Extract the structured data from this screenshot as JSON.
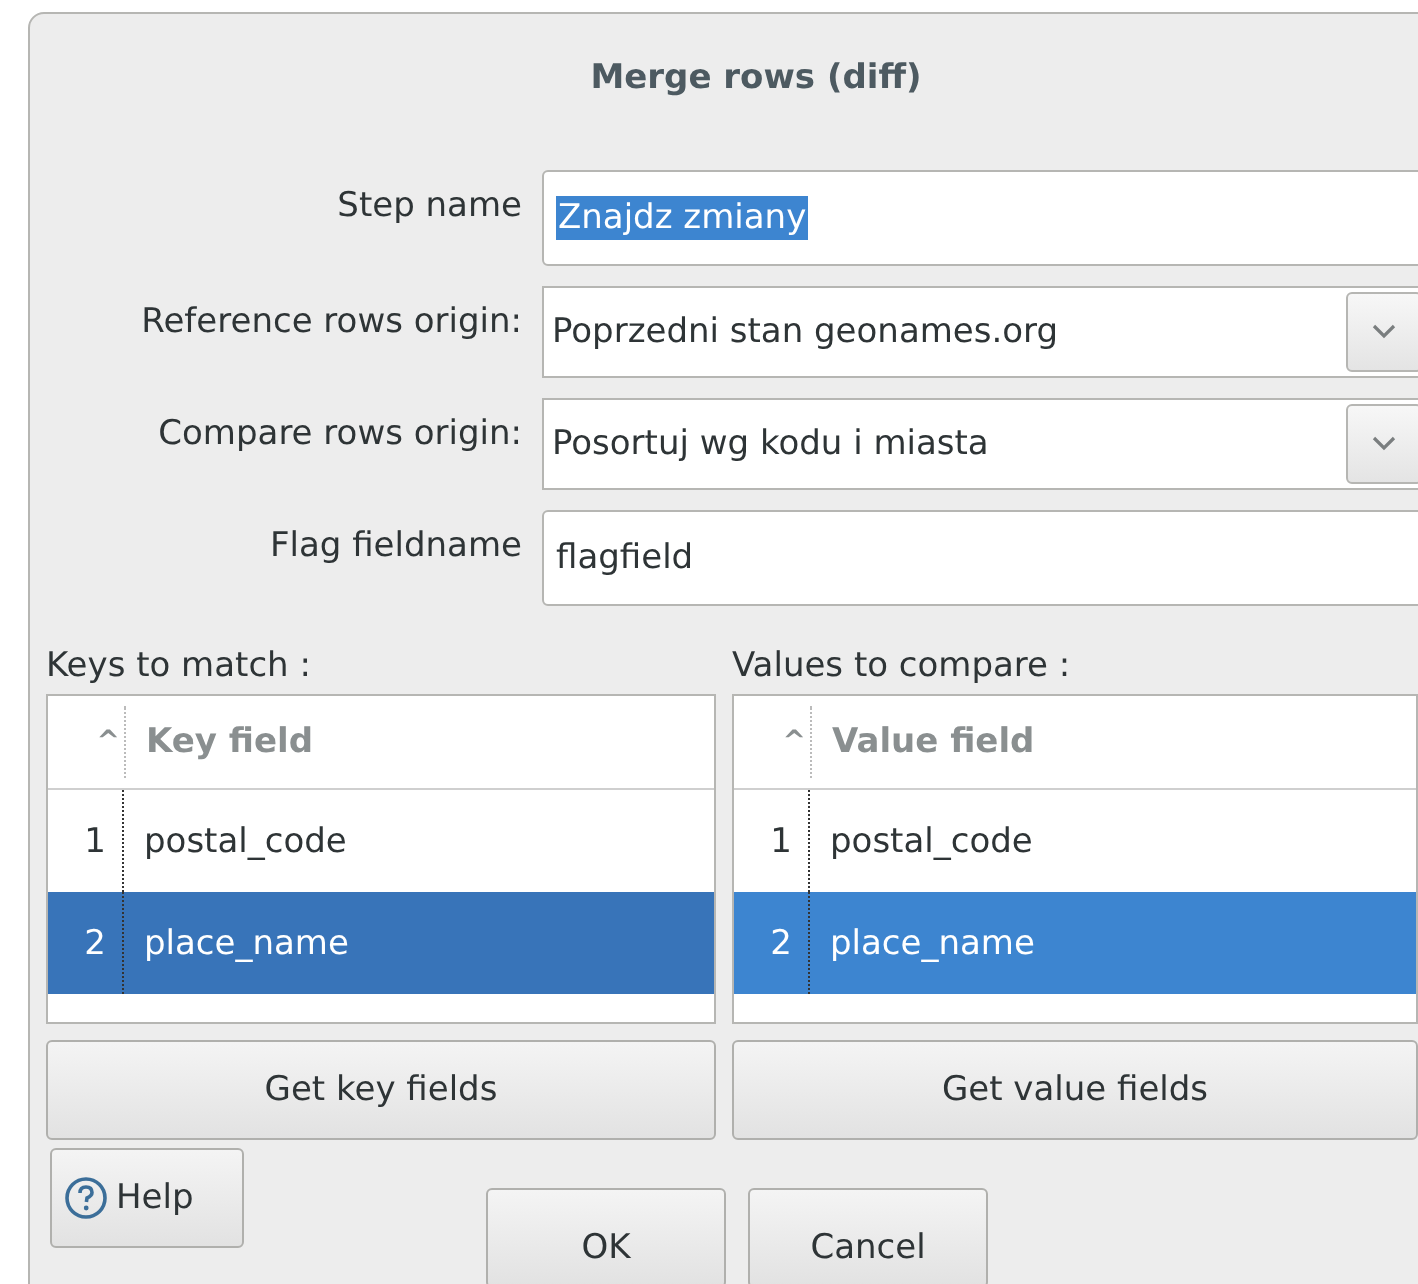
{
  "window": {
    "title": "Merge rows (diff)"
  },
  "fields": [
    {
      "kind": "text",
      "label": "Step name",
      "value": "Znajdz zmiany",
      "text_selected": true
    },
    {
      "kind": "combo",
      "label": "Reference rows origin:",
      "value": "Poprzedni stan geonames.org"
    },
    {
      "kind": "combo",
      "label": "Compare rows origin:",
      "value": "Posortuj wg kodu i miasta"
    },
    {
      "kind": "text",
      "label": "Flag fieldname",
      "value": "flagfield",
      "text_selected": false
    }
  ],
  "tables": [
    {
      "label": "Keys to match :",
      "focused": true,
      "sort_indicator": "^",
      "column": "Key field",
      "button": "Get key fields",
      "rows": [
        {
          "index": "1",
          "value": "postal_code",
          "selected": false
        },
        {
          "index": "2",
          "value": "place_name",
          "selected": true
        }
      ]
    },
    {
      "label": "Values to compare :",
      "focused": false,
      "sort_indicator": "^",
      "column": "Value field",
      "button": "Get value fields",
      "rows": [
        {
          "index": "1",
          "value": "postal_code",
          "selected": false
        },
        {
          "index": "2",
          "value": "place_name",
          "selected": true
        }
      ]
    }
  ],
  "help_button": "Help",
  "buttons": [
    "OK",
    "Cancel"
  ]
}
